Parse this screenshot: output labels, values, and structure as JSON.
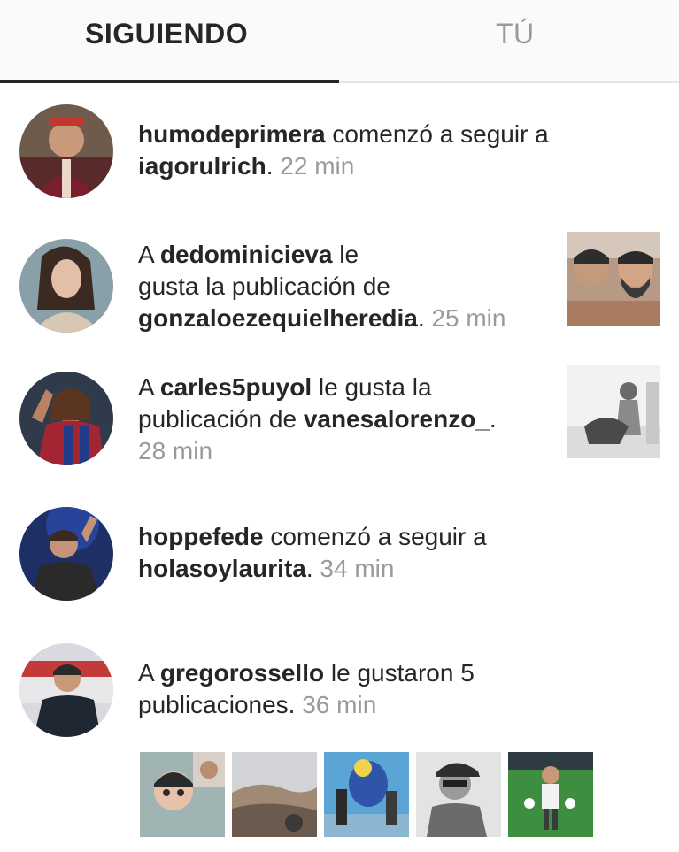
{
  "tabs": {
    "following": "SIGUIENDO",
    "you": "TÚ"
  },
  "feed": [
    {
      "user": "humodeprimera",
      "action": " comenzó a seguir a",
      "target": "iagorulrich",
      "end": ".",
      "time": "22 min"
    },
    {
      "prefix": "A ",
      "user": "dedominicieva",
      "action_line1": " le",
      "action_line2": "gusta la publicación de",
      "target": "gonzaloezequielheredia",
      "end": ".",
      "time": "25 min"
    },
    {
      "prefix": "A ",
      "user": "carles5puyol",
      "action_line1": " le gusta la",
      "action_line2": "publicación de ",
      "target": "vanesalorenzo_",
      "end": ".",
      "time": "28 min"
    },
    {
      "user": "hoppefede",
      "action": " comenzó a seguir a",
      "target": "holasoylaurita",
      "end": ".",
      "time": "34 min"
    },
    {
      "prefix": "A ",
      "user": "gregorossello",
      "action_line1": " le gustaron 5",
      "action_line2": "publicaciones",
      "end": ".",
      "time": "36 min"
    }
  ],
  "colors": {
    "text": "#262626",
    "muted": "#9a9a9a",
    "indicator": "#262626"
  }
}
